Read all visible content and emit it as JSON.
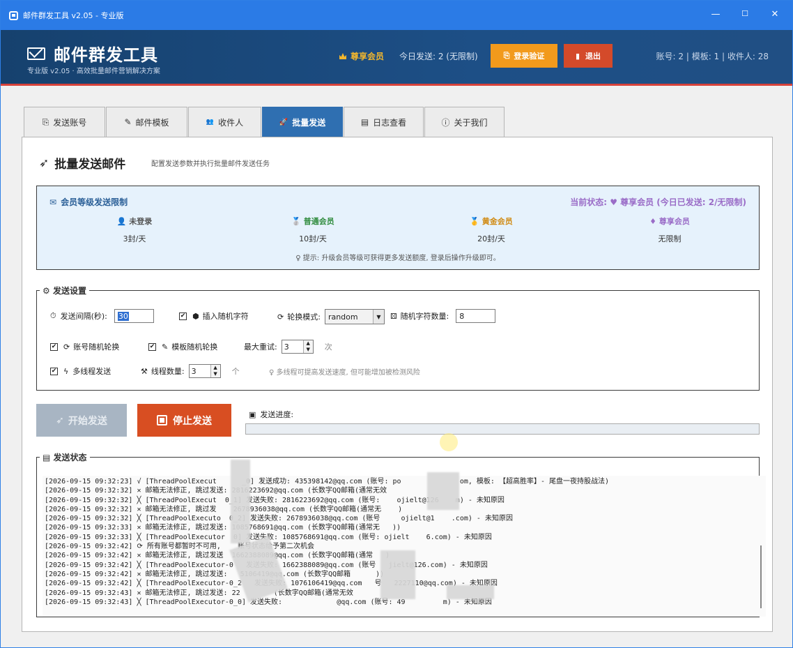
{
  "window": {
    "title": "邮件群发工具 v2.05 - 专业版",
    "min": "—",
    "max": "☐",
    "close": "✕"
  },
  "header": {
    "brand": "邮件群发工具",
    "subtitle": "专业版 v2.05 · 高效批量邮件营销解决方案",
    "member_label": "尊享会员",
    "today": "今日发送: 2 (无限制)",
    "login_btn": "登录验证",
    "logout_btn": "退出",
    "stats": "账号: 2 | 模板: 1 | 收件人: 28"
  },
  "tabs": [
    {
      "icon": "⎘",
      "label": "发送账号"
    },
    {
      "icon": "✎",
      "label": "邮件模板"
    },
    {
      "icon": "👥",
      "label": "收件人"
    },
    {
      "icon": "🚀",
      "label": "批量发送"
    },
    {
      "icon": "▤",
      "label": "日志查看"
    },
    {
      "icon": "ⓘ",
      "label": "关于我们"
    }
  ],
  "page": {
    "title": "批量发送邮件",
    "desc": "配置发送参数并执行批量邮件发送任务"
  },
  "vip": {
    "title": "会员等级发送限制",
    "status": "当前状态: ♥ 尊享会员 (今日已发送: 2/无限制)",
    "levels": [
      {
        "name": "未登录",
        "quota": "3封/天",
        "color": "#555555"
      },
      {
        "name": "普通会员",
        "quota": "10封/天",
        "color": "#2e8b3c"
      },
      {
        "name": "黄金会员",
        "quota": "20封/天",
        "color": "#d08a12"
      },
      {
        "name": "尊享会员",
        "quota": "无限制",
        "color": "#9a6cc7"
      }
    ],
    "tip": "♀ 提示: 升级会员等级可获得更多发送额度, 登录后操作升级即可。"
  },
  "settings": {
    "legend": "发送设置",
    "interval_label": "发送间隔(秒):",
    "interval_value": "30",
    "insert_random": "插入随机字符",
    "rotate_mode_label": "轮换模式:",
    "rotate_mode_value": "random",
    "random_count_label": "随机字符数量:",
    "random_count_value": "8",
    "account_rotate": "账号随机轮换",
    "template_rotate": "模板随机轮换",
    "max_retry_label": "最大重试:",
    "max_retry_value": "3",
    "retry_unit": "次",
    "multi_thread": "多线程发送",
    "thread_count_label": "线程数量:",
    "thread_count_value": "3",
    "thread_unit": "个",
    "thread_tip": "♀ 多线程可提高发送速度, 但可能增加被检测风险"
  },
  "actions": {
    "start": "开始发送",
    "stop": "停止发送",
    "progress_label": "发送进度:",
    "progress": 0
  },
  "log": {
    "legend": "发送状态",
    "lines": [
      "[2026-09-15 09:32:23] √ [ThreadPoolExecut      _0] 发送成功: 435398142@qq.com (账号: po              om, 模板: 【超高胜率】- 尾盘一夜持股战法)",
      "[2026-09-15 09:32:32] ✕ 邮箱无法修正, 跳过发送: 2816223692@qq.com (长数字QQ邮箱(通常无效",
      "[2026-09-15 09:32:32] ╳ [ThreadPoolExecut  0_1] 发送失败: 2816223692@qq.com (账号:    ojielt@126    m) - 未知原因",
      "[2026-09-15 09:32:32] ✕ 邮箱无法修正, 跳过发    2678936038@qq.com (长数字QQ邮箱(通常无    )",
      "[2026-09-15 09:32:32] ╳ [ThreadPoolExecuto  0_2] 发送失败: 2678936038@qq.com (账号     ojielt@1    .com) - 未知原因",
      "[2026-09-15 09:32:33] ✕ 邮箱无法修正, 跳过发送: 1085768691@qq.com (长数字QQ邮箱(通常无   ))",
      "[2026-09-15 09:32:33] ╳ [ThreadPoolExecutor  0] 发送失败: 1085768691@qq.com (账号: ojielt    6.com) - 未知原因",
      "[2026-09-15 09:32:42] ⟳ 所有账号都暂时不可用,    账号状态给予第二次机会",
      "[2026-09-15 09:32:42] ✕ 邮箱无法修正, 跳过发送  1662388089@qq.com (长数字QQ邮箱(通常   )",
      "[2026-09-15 09:32:42] ╳ [ThreadPoolExecutor-0   发送失败: 1662388089@qq.com (账号   jielt@126.com) - 未知原因",
      "[2026-09-15 09:32:42] ✕ 邮箱无法修正, 跳过发送:   5106419@qq.com (长数字QQ邮箱      ))",
      "[2026-09-15 09:32:42] ╳ [ThreadPoolExecutor-0_2   发送失败: 1076106419@qq.com   号   2227110@qq.com) - 未知原因",
      "[2026-09-15 09:32:43] ✕ 邮箱无法修正, 跳过发送: 22        (长数字QQ邮箱(通常无效",
      "[2026-09-15 09:32:43] ╳ [ThreadPoolExecutor-0_0] 发送失败:             @qq.com (账号: 49         m) - 未知原因"
    ]
  }
}
